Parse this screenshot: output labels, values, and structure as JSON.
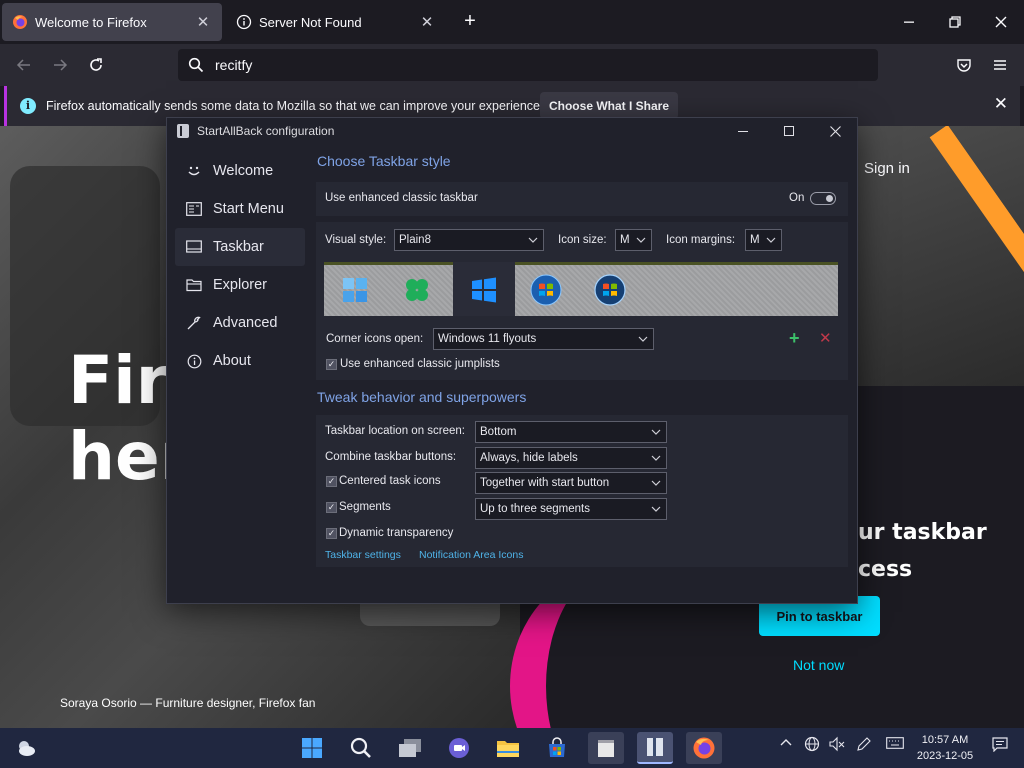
{
  "browser": {
    "tabs": [
      {
        "label": "Welcome to Firefox",
        "icon": "firefox-icon",
        "active": true
      },
      {
        "label": "Server Not Found",
        "icon": "info-icon",
        "active": false
      }
    ],
    "url_value": "recitfy",
    "notification": {
      "text": "Firefox automatically sends some data to Mozilla so that we can improve your experience.",
      "button": "Choose What I Share"
    }
  },
  "page": {
    "hero_line1": "Fire",
    "hero_line2": "her",
    "sign_in": "Sign in",
    "right_title1": "ur taskbar",
    "right_title2": "cess",
    "pin_button": "Pin to taskbar",
    "not_now": "Not now",
    "caption": "Soraya Osorio — Furniture designer, Firefox fan"
  },
  "dialog": {
    "title": "StartAllBack configuration",
    "nav": [
      {
        "label": "Welcome",
        "icon": "smile-icon",
        "selected": false
      },
      {
        "label": "Start Menu",
        "icon": "start-menu-icon",
        "selected": false
      },
      {
        "label": "Taskbar",
        "icon": "taskbar-icon",
        "selected": true
      },
      {
        "label": "Explorer",
        "icon": "folder-icon",
        "selected": false
      },
      {
        "label": "Advanced",
        "icon": "wrench-icon",
        "selected": false
      },
      {
        "label": "About",
        "icon": "info-icon",
        "selected": false
      }
    ],
    "section1_title": "Choose Taskbar style",
    "enhanced_label": "Use enhanced classic taskbar",
    "enhanced_state": "On",
    "visual_style_label": "Visual style:",
    "visual_style_value": "Plain8",
    "icon_size_label": "Icon size:",
    "icon_size_value": "M",
    "icon_margins_label": "Icon margins:",
    "icon_margins_value": "M",
    "corner_label": "Corner icons open:",
    "corner_value": "Windows 11 flyouts",
    "jumplists_label": "Use enhanced classic jumplists",
    "section2_title": "Tweak behavior and superpowers",
    "location_label": "Taskbar location on screen:",
    "location_value": "Bottom",
    "combine_label": "Combine taskbar buttons:",
    "combine_value": "Always, hide labels",
    "centered_label": "Centered task icons",
    "centered_value": "Together with start button",
    "segments_label": "Segments",
    "segments_value": "Up to three segments",
    "dynamic_label": "Dynamic transparency",
    "link1": "Taskbar settings",
    "link2": "Notification Area Icons"
  },
  "taskbar": {
    "time": "10:57 AM",
    "date": "2023-12-05"
  },
  "colors": {
    "accent_blue": "#7fa3e6",
    "link_cyan": "#4fb3e8",
    "firefox_cyan": "#00ddff",
    "pink": "#e31587",
    "orange": "#ff9c2a"
  }
}
